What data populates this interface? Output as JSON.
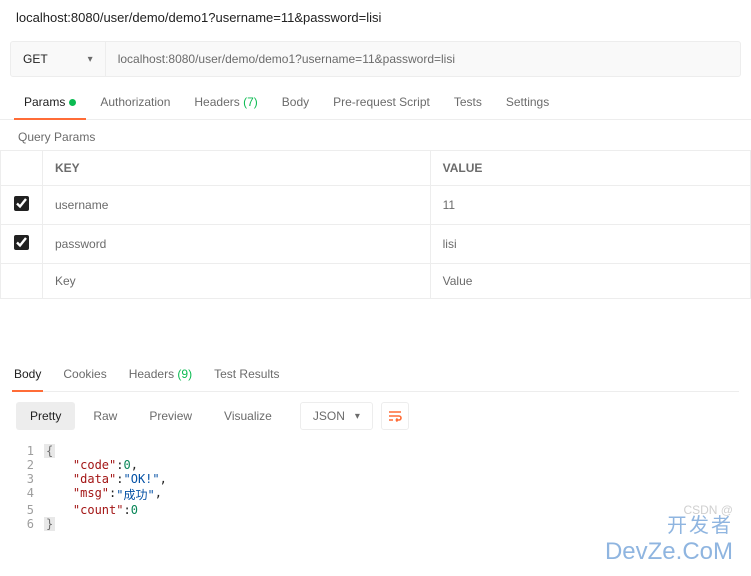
{
  "title_url": "localhost:8080/user/demo/demo1?username=11&password=lisi",
  "method": "GET",
  "url_input": "localhost:8080/user/demo/demo1?username=11&password=lisi",
  "tabs": {
    "params": "Params",
    "authorization": "Authorization",
    "headers": "Headers",
    "headers_count": "(7)",
    "body": "Body",
    "prerequest": "Pre-request Script",
    "tests": "Tests",
    "settings": "Settings"
  },
  "query_params_label": "Query Params",
  "table": {
    "key_header": "KEY",
    "value_header": "VALUE",
    "rows": [
      {
        "key": "username",
        "value": "11"
      },
      {
        "key": "password",
        "value": "lisi"
      }
    ],
    "key_placeholder": "Key",
    "value_placeholder": "Value"
  },
  "response_tabs": {
    "body": "Body",
    "cookies": "Cookies",
    "headers": "Headers",
    "headers_count": "(9)",
    "test_results": "Test Results"
  },
  "view_modes": {
    "pretty": "Pretty",
    "raw": "Raw",
    "preview": "Preview",
    "visualize": "Visualize"
  },
  "format_dd": "JSON",
  "json_body": {
    "code_key": "\"code\"",
    "code_val": "0",
    "data_key": "\"data\"",
    "data_val": "\"OK!\"",
    "msg_key": "\"msg\"",
    "msg_val": "\"成功\"",
    "count_key": "\"count\"",
    "count_val": "0"
  },
  "gutter": [
    "1",
    "2",
    "3",
    "4",
    "5",
    "6"
  ],
  "watermark": {
    "csdn": "CSDN @",
    "cn": "开发者",
    "en": "DevZe.CoM"
  }
}
